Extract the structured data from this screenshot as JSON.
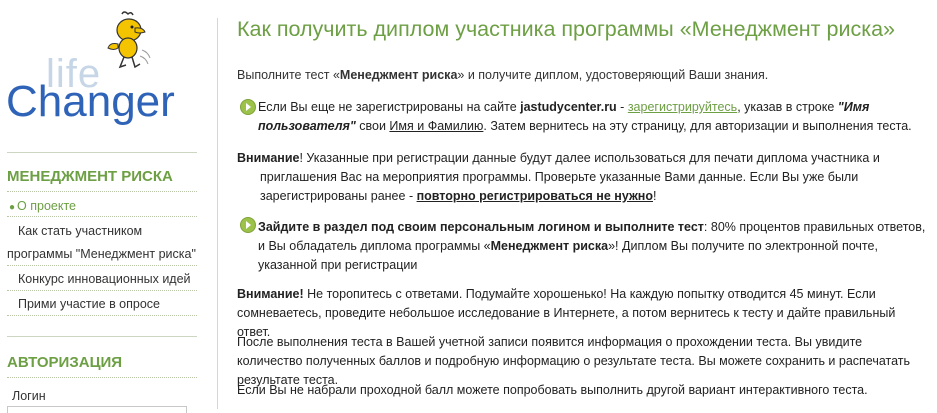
{
  "logo": {
    "life": "life",
    "changer": "Changer"
  },
  "sidebar": {
    "heading_program": "МЕНЕДЖМЕНТ РИСКА",
    "items": [
      {
        "label": "О проекте"
      },
      {
        "label_line1": "Как стать участником",
        "label_line2": "программы \"Менеджмент риска\""
      },
      {
        "label": "Конкурс инновационных идей"
      },
      {
        "label": "Прими участие в опросе"
      }
    ],
    "heading_auth": "АВТОРИЗАЦИЯ",
    "login_label": "Логин"
  },
  "main": {
    "title": "Как получить диплом участника программы «Менеджмент риска»",
    "subtitle": {
      "a": "Выполните тест «",
      "b": "Менеджмент риска",
      "c": "» и получите диплом, удостоверяющий Ваши знания."
    },
    "p1": {
      "a": "Если Вы еще не зарегистрированы на сайте ",
      "site": "jastudycenter.ru",
      "b": " - ",
      "register_link": "зарегистрируйтесь",
      "c": ", указав в строке ",
      "field_name": "\"Имя пользователя\"",
      "d": " свои ",
      "name_ul": "Имя и Фамилию",
      "e": ". Затем вернитесь на эту страницу, для авторизации и выполнения теста."
    },
    "p2": {
      "label": "Внимание",
      "a": "! Указанные при регистрации данные будут далее использоваться для печати диплома участника и",
      "b": "приглашения Вас на мероприятия программы. Проверьте указанные Вами данные. Если Вы уже были",
      "c": "зарегистрированы ранее - ",
      "warn": "повторно регистрироваться не нужно",
      "d": "!"
    },
    "p3": {
      "bold": "Зайдите в раздел под своим персональным логином и выполните тест",
      "a": ":  80% процентов правильных ответов, и Вы обладатель диплома программы «",
      "prog": "Менеджмент риска",
      "b": "»!  Диплом Вы получите по электронной почте, указанной при регистрации"
    },
    "p4": {
      "label": "Внимание!",
      "text": " Не торопитесь с ответами. Подумайте хорошенько! На каждую попытку отводится 45 минут. Если сомневаетесь, проведите небольшое исследование в Интернете, а потом вернитесь к тесту и дайте правильный ответ."
    },
    "p5": "После выполнения теста в Вашей учетной записи появится информация о прохождении теста. Вы увидите количество полученных баллов и подробную информацию о результате теста. Вы можете сохранить и распечатать результате теста.",
    "p6": "Если Вы не набрали проходной балл можете попробовать выполнить другой вариант интерактивного теста."
  },
  "colors": {
    "accent": "#6d9f44",
    "logo_blue": "#2f63b8",
    "logo_light": "#c6d6e6"
  },
  "icons": {
    "bullet_arrow": "green-circle-arrow-icon",
    "logo_mascot": "bird-mascot-icon"
  }
}
